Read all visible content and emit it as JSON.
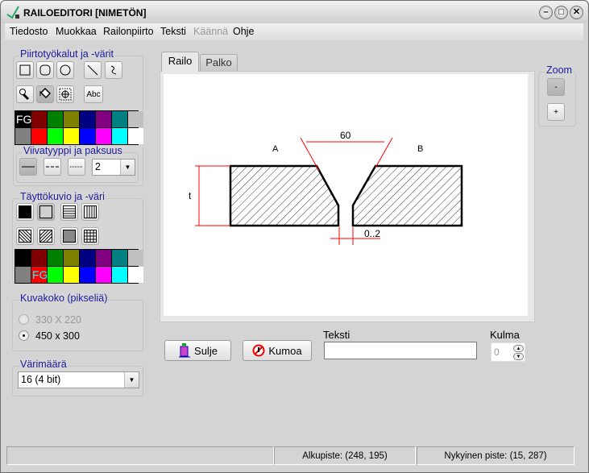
{
  "window": {
    "title": "RAILOEDITORI [NIMETÖN]",
    "minimize": "–",
    "maximize": "□",
    "close": "✕"
  },
  "menu": [
    "Tiedosto",
    "Muokkaa",
    "Railonpiirto",
    "Teksti",
    "Käännä",
    "Ohje"
  ],
  "tools_group": {
    "label": "Piirtotyökalut ja -värit",
    "text_tool": "Abc",
    "fg_label": "FG",
    "palette": [
      "#000000",
      "#800000",
      "#008000",
      "#808000",
      "#000080",
      "#800080",
      "#008080",
      "#c0c0c0",
      "#808080",
      "#ff0000",
      "#00ff00",
      "#ffff00",
      "#0000ff",
      "#ff00ff",
      "#00ffff",
      "#ffffff"
    ]
  },
  "line_group": {
    "label": "Viivatyyppi ja paksuus",
    "thickness": "2"
  },
  "fill_group": {
    "label": "Täyttökuvio ja -väri",
    "fg_label": "FG"
  },
  "size_group": {
    "label": "Kuvakoko (pikseliä)",
    "options": [
      "330 X 220",
      "450 x 300"
    ],
    "selected": "450 x 300"
  },
  "colors_group": {
    "label": "Värimäärä",
    "value": "16 (4 bit)"
  },
  "tabs": [
    "Railo",
    "Palko"
  ],
  "drawing": {
    "angle": "60",
    "label_a": "A",
    "label_b": "B",
    "thickness": "t",
    "gap": "0..2"
  },
  "zoom": {
    "label": "Zoom",
    "minus": "-",
    "plus": "+"
  },
  "actions": {
    "close": "Sulje",
    "undo": "Kumoa",
    "text_label": "Teksti",
    "text_value": "",
    "angle_label": "Kulma",
    "angle_value": "0"
  },
  "status": {
    "start": "Alkupiste: (248, 195)",
    "current": "Nykyinen piste: (15, 287)"
  }
}
